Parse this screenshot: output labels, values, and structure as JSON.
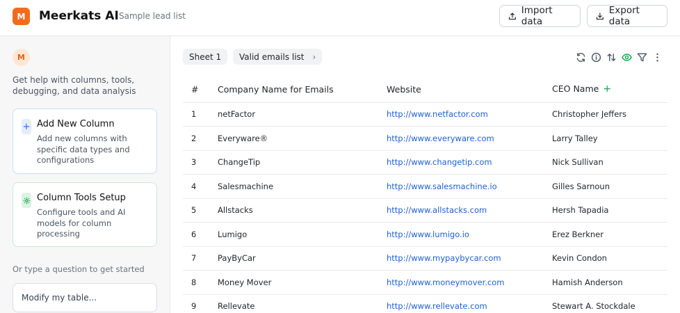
{
  "app": {
    "logo_letter": "M",
    "title": "Meerkats AI",
    "subtitle": "Sample lead list"
  },
  "header": {
    "import_label": "Import data",
    "export_label": "Export data"
  },
  "sidebar": {
    "avatar_letter": "M",
    "help_text": "Get help with columns, tools, debugging, and data analysis",
    "cards": [
      {
        "icon": "plus-icon",
        "title": "Add New Column",
        "description": "Add new columns with specific data types and configurations"
      },
      {
        "icon": "gear-icon",
        "title": "Column Tools Setup",
        "description": "Configure tools and AI models for column processing"
      }
    ],
    "prompt_text": "Or type a question to get started",
    "input_placeholder": "Modify my table..."
  },
  "tabs": {
    "sheet": "Sheet 1",
    "valid": "Valid emails list"
  },
  "toolbar_icons": [
    "refresh-icon",
    "info-icon",
    "sort-icon",
    "eye-icon",
    "filter-icon",
    "more-icon"
  ],
  "table": {
    "columns": [
      "#",
      "Company Name for Emails",
      "Website",
      "CEO Name"
    ],
    "rows": [
      {
        "num": "1",
        "company": "netFactor",
        "website": "http://www.netfactor.com",
        "ceo": "Christopher Jeffers"
      },
      {
        "num": "2",
        "company": "Everyware®",
        "website": "http://www.everyware.com",
        "ceo": "Larry Talley"
      },
      {
        "num": "3",
        "company": "ChangeTip",
        "website": "http://www.changetip.com",
        "ceo": "Nick Sullivan"
      },
      {
        "num": "4",
        "company": "Salesmachine",
        "website": "http://www.salesmachine.io",
        "ceo": "Gilles Sarnoun"
      },
      {
        "num": "5",
        "company": "Allstacks",
        "website": "http://www.allstacks.com",
        "ceo": "Hersh Tapadia"
      },
      {
        "num": "6",
        "company": "Lumigo",
        "website": "http://www.lumigo.io",
        "ceo": "Erez Berkner"
      },
      {
        "num": "7",
        "company": "PayByCar",
        "website": "http://www.mypaybycar.com",
        "ceo": "Kevin Condon"
      },
      {
        "num": "8",
        "company": "Money Mover",
        "website": "http://www.moneymover.com",
        "ceo": "Hamish Anderson"
      },
      {
        "num": "9",
        "company": "Rellevate",
        "website": "http://www.rellevate.com",
        "ceo": "Stewart A. Stockdale"
      }
    ]
  },
  "colors": {
    "brand": "#f26b1d",
    "link": "#1d5fd6",
    "accent_green": "#16a34a",
    "accent_blue": "#2563eb"
  }
}
